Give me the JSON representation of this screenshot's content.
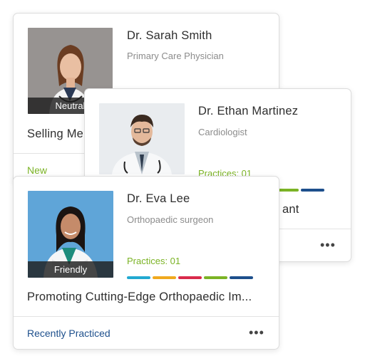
{
  "cards": {
    "back": {
      "name": "Dr. Sarah Smith",
      "specialty": "Primary Care Physician",
      "mood": "Neutral",
      "topic": "Selling Me",
      "status": "New",
      "status_color": "#7bb325"
    },
    "middle": {
      "name": "Dr. Ethan Martinez",
      "specialty": "Cardiologist",
      "practices": "Practices: 01",
      "topic_fragment": "ant",
      "more_label": "•••"
    },
    "front": {
      "name": "Dr. Eva Lee",
      "specialty": "Orthopaedic surgeon",
      "practices": "Practices: 01",
      "mood": "Friendly",
      "topic": "Promoting Cutting-Edge Orthopaedic Im...",
      "status": "Recently Practiced",
      "status_color": "#1d4f8c",
      "more_label": "•••"
    }
  },
  "progress_colors": [
    "#22a9d1",
    "#f0a91e",
    "#d92b4b",
    "#7bb325",
    "#1d4f8c"
  ],
  "icons": {
    "more": "more-horizontal-icon"
  }
}
